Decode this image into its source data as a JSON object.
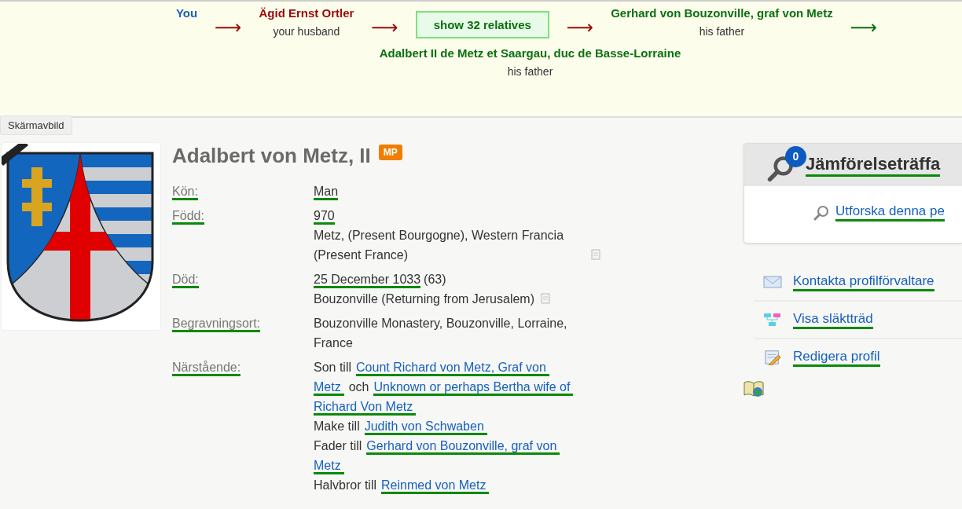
{
  "banner": {
    "chain": [
      {
        "kind": "person",
        "name": "You",
        "color": "#1a5fc0"
      },
      {
        "kind": "arrow",
        "text": "⟶",
        "color": "#9a0a0a"
      },
      {
        "kind": "person",
        "name": "Ägid Ernst Ortler",
        "relation": "your husband",
        "color": "#9a0a0a"
      },
      {
        "kind": "arrow",
        "text": "⟶",
        "color": "#9a0a0a"
      },
      {
        "kind": "button",
        "label": "show 32 relatives"
      },
      {
        "kind": "arrow",
        "text": "⟶",
        "color": "#9a0a0a"
      },
      {
        "kind": "person",
        "name": "Gerhard von Bouzonville, graf von Metz",
        "relation": "his father",
        "color": "#0a7010"
      },
      {
        "kind": "arrow",
        "text": "⟶",
        "color": "#0a7010"
      }
    ],
    "target": {
      "name": "Adalbert II de Metz et Saargau, duc de Basse-Lorraine",
      "relation": "his father",
      "color": "#0a7010"
    }
  },
  "tooltip": "Skärmavbild",
  "profile": {
    "name": "Adalbert von Metz, II",
    "badge": "MP",
    "facts": [
      {
        "label": "Kön:",
        "value": "Man"
      },
      {
        "label": "Född:",
        "date": "970",
        "place": "Metz, (Present Bourgogne), Western Francia (Present France)",
        "source_icon": true
      },
      {
        "label": "Död:",
        "date": "25 December 1033",
        "age": "(63)",
        "place": "Bouzonville (Returning from Jerusalem)",
        "source_icon": true
      },
      {
        "label": "Begravningsort:",
        "place": "Bouzonville Monastery, Bouzonville, Lorraine, France"
      }
    ],
    "relatives_label": "Närstående:",
    "relatives": [
      {
        "lines": [
          [
            {
              "kind": "text",
              "text": "Son till"
            },
            {
              "kind": "link",
              "text": "Count Richard von Metz, Graf von"
            }
          ],
          [
            {
              "kind": "link",
              "text": "Metz"
            },
            {
              "kind": "text",
              "text": "och"
            },
            {
              "kind": "link",
              "text": "Unknown or perhaps Bertha wife of"
            }
          ],
          [
            {
              "kind": "link",
              "text": "Richard Von Metz"
            }
          ]
        ]
      },
      {
        "lines": [
          [
            {
              "kind": "text",
              "text": "Make till"
            },
            {
              "kind": "link",
              "text": "Judith von Schwaben"
            }
          ]
        ]
      },
      {
        "lines": [
          [
            {
              "kind": "text",
              "text": "Fader till"
            },
            {
              "kind": "link",
              "text": "Gerhard von Bouzonville, graf von"
            }
          ],
          [
            {
              "kind": "link",
              "text": "Metz"
            }
          ]
        ]
      },
      {
        "lines": [
          [
            {
              "kind": "text",
              "text": "Halvbror till"
            },
            {
              "kind": "link",
              "text": "Reinmed von Metz"
            }
          ]
        ]
      }
    ]
  },
  "matches": {
    "count": "0",
    "title": "Jämförelseträffa",
    "explore": "Utforska denna pe"
  },
  "actions": [
    {
      "kind": "mail",
      "label": "Kontakta profilförvaltare"
    },
    {
      "kind": "tree",
      "label": "Visa släktträd"
    },
    {
      "kind": "edit",
      "label": "Redigera profil"
    }
  ]
}
